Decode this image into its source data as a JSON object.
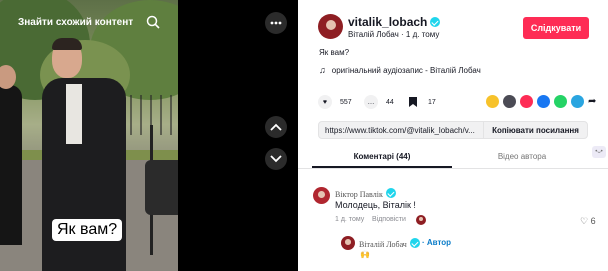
{
  "video": {
    "header": "Знайти схожий контент",
    "caption": "Як вам?"
  },
  "author": {
    "username": "vitalik_lobach",
    "display_name": "Віталій Лобач",
    "time": "1 д. тому",
    "follow_label": "Слідкувати"
  },
  "post": {
    "description": "Як вам?",
    "music": "оригінальний аудіозапис - Віталій Лобач"
  },
  "stats": {
    "likes": "557",
    "comments": "44",
    "saves": "17"
  },
  "link": {
    "url": "https://www.tiktok.com/@vitalik_lobach/v...",
    "copy_label": "Копіювати посилання"
  },
  "tabs": {
    "comments": "Коментарі (44)",
    "videos": "Відео автора"
  },
  "comment": {
    "author": "Віктор Павлік",
    "text": "Молодець, Віталік !",
    "time": "1 д. тому",
    "reply_label": "Відповісти",
    "likes": "6"
  },
  "reply": {
    "author": "Віталій Лобач",
    "badge": "Автор",
    "text": "🙌"
  },
  "colors": {
    "accent": "#fe2c55",
    "verified": "#20d5ec"
  },
  "icons": [
    "search-icon",
    "more-icon",
    "chevron-up-icon",
    "chevron-down-icon",
    "heart-icon",
    "comment-icon",
    "bookmark-icon",
    "music-note-icon"
  ]
}
